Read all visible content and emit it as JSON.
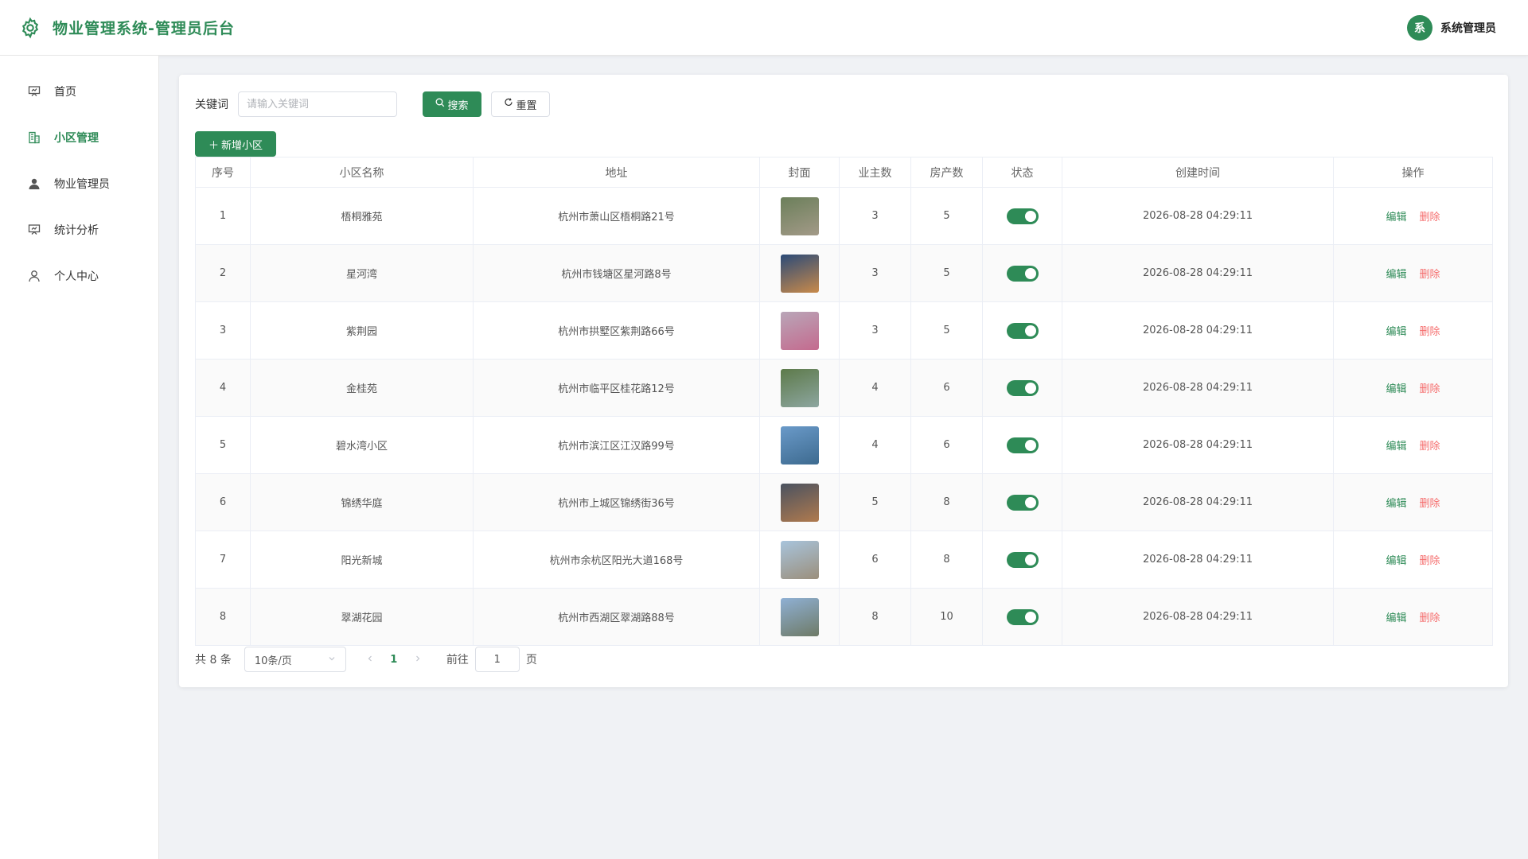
{
  "app": {
    "title": "物业管理系统-管理员后台"
  },
  "user": {
    "avatar_text": "系",
    "name": "系统管理员"
  },
  "sidebar": {
    "items": [
      {
        "label": "首页",
        "icon": "presentation-board-icon",
        "active": false
      },
      {
        "label": "小区管理",
        "icon": "building-icon",
        "active": true
      },
      {
        "label": "物业管理员",
        "icon": "user-filled-icon",
        "active": false
      },
      {
        "label": "统计分析",
        "icon": "presentation-board-icon",
        "active": false
      },
      {
        "label": "个人中心",
        "icon": "user-outline-icon",
        "active": false
      }
    ]
  },
  "search": {
    "label": "关键词",
    "placeholder": "请输入关键词",
    "value": "",
    "search_button": "搜索",
    "reset_button": "重置"
  },
  "toolbar": {
    "add_button": "新增小区"
  },
  "table": {
    "columns": [
      "序号",
      "小区名称",
      "地址",
      "封面",
      "业主数",
      "房产数",
      "状态",
      "创建时间",
      "操作"
    ],
    "edit_label": "编辑",
    "delete_label": "删除",
    "rows": [
      {
        "no": "1",
        "name": "梧桐雅苑",
        "address": "杭州市萧山区梧桐路21号",
        "owners": "3",
        "properties": "5",
        "status_on": true,
        "created": "2026-08-28 04:29:11",
        "cover_colors": [
          "#6b7f5a",
          "#a39a88"
        ]
      },
      {
        "no": "2",
        "name": "星河湾",
        "address": "杭州市钱塘区星河路8号",
        "owners": "3",
        "properties": "5",
        "status_on": true,
        "created": "2026-08-28 04:29:11",
        "cover_colors": [
          "#2b4a78",
          "#c98a4a"
        ]
      },
      {
        "no": "3",
        "name": "紫荆园",
        "address": "杭州市拱墅区紫荆路66号",
        "owners": "3",
        "properties": "5",
        "status_on": true,
        "created": "2026-08-28 04:29:11",
        "cover_colors": [
          "#b9a6b8",
          "#c46a8e"
        ]
      },
      {
        "no": "4",
        "name": "金桂苑",
        "address": "杭州市临平区桂花路12号",
        "owners": "4",
        "properties": "6",
        "status_on": true,
        "created": "2026-08-28 04:29:11",
        "cover_colors": [
          "#5d7a4a",
          "#8da6a0"
        ]
      },
      {
        "no": "5",
        "name": "碧水湾小区",
        "address": "杭州市滨江区江汉路99号",
        "owners": "4",
        "properties": "6",
        "status_on": true,
        "created": "2026-08-28 04:29:11",
        "cover_colors": [
          "#6a9ac9",
          "#3d6a8f"
        ]
      },
      {
        "no": "6",
        "name": "锦绣华庭",
        "address": "杭州市上城区锦绣街36号",
        "owners": "5",
        "properties": "8",
        "status_on": true,
        "created": "2026-08-28 04:29:11",
        "cover_colors": [
          "#4a5260",
          "#b07a4e"
        ]
      },
      {
        "no": "7",
        "name": "阳光新城",
        "address": "杭州市余杭区阳光大道168号",
        "owners": "6",
        "properties": "8",
        "status_on": true,
        "created": "2026-08-28 04:29:11",
        "cover_colors": [
          "#a8c4dc",
          "#9b8f7c"
        ]
      },
      {
        "no": "8",
        "name": "翠湖花园",
        "address": "杭州市西湖区翠湖路88号",
        "owners": "8",
        "properties": "10",
        "status_on": true,
        "created": "2026-08-28 04:29:11",
        "cover_colors": [
          "#8fb0d4",
          "#6e7a66"
        ]
      }
    ]
  },
  "pagination": {
    "total_text": "共 8 条",
    "page_size": "10条/页",
    "current_page": "1",
    "goto_label": "前往",
    "goto_value": "1",
    "page_suffix": "页"
  },
  "colors": {
    "accent": "#2e8b57",
    "danger": "#f56c6c"
  }
}
